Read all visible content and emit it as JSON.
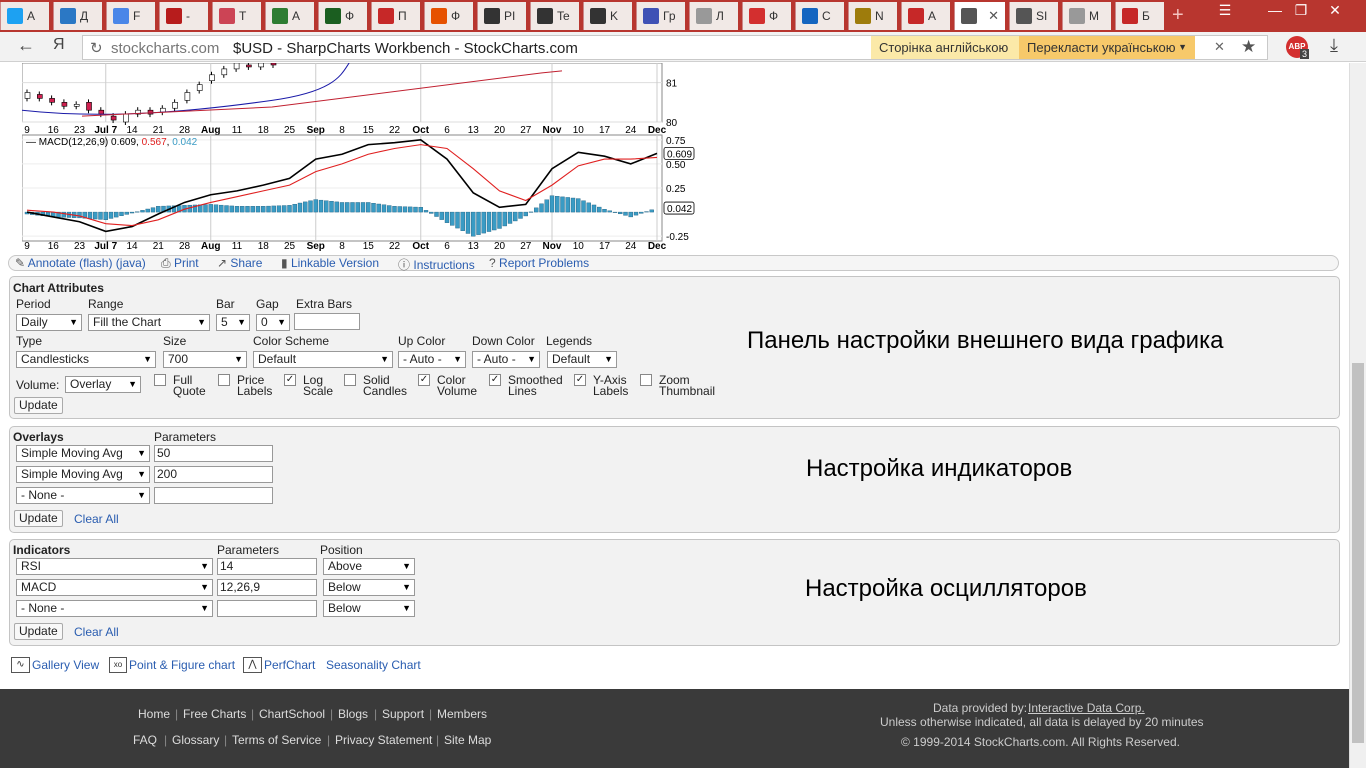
{
  "browser": {
    "tabs": [
      {
        "icon": "twitter-icon",
        "label": "A",
        "color": "#1da1f2"
      },
      {
        "icon": "m-icon",
        "label": "Д",
        "color": "#2b78c5"
      },
      {
        "icon": "g-icon",
        "label": "F",
        "color": "#4a86e8"
      },
      {
        "icon": "f-icon",
        "label": "-",
        "color": "#b71c1c"
      },
      {
        "icon": "chart-icon",
        "label": "T",
        "color": "#c45"
      },
      {
        "icon": "grid-icon",
        "label": "A",
        "color": "#2e7d32"
      },
      {
        "icon": "bars-icon",
        "label": "Ф",
        "color": "#1b5e20"
      },
      {
        "icon": "blocks-icon",
        "label": "П",
        "color": "#c62828"
      },
      {
        "icon": "circle-f-icon",
        "label": "Ф",
        "color": "#e65100"
      },
      {
        "icon": "ft-icon",
        "label": "PI",
        "color": "#333"
      },
      {
        "icon": "ft-icon",
        "label": "Te",
        "color": "#333"
      },
      {
        "icon": "ft-icon",
        "label": "K",
        "color": "#333"
      },
      {
        "icon": "pinwheel-icon",
        "label": "Гр",
        "color": "#3f51b5"
      },
      {
        "icon": "doc-icon",
        "label": "Л",
        "color": "#999"
      },
      {
        "icon": "f-script-icon",
        "label": "Ф",
        "color": "#d32f2f"
      },
      {
        "icon": "ob-icon",
        "label": "С",
        "color": "#1565c0"
      },
      {
        "icon": "coin-icon",
        "label": "N",
        "color": "#9e7c0c"
      },
      {
        "icon": "fa-icon",
        "label": "A",
        "color": "#c62828"
      },
      {
        "icon": "stockcharts-icon",
        "label": "",
        "color": "#555",
        "active": true
      },
      {
        "icon": "stockcharts-icon",
        "label": "SI",
        "color": "#555"
      },
      {
        "icon": "doc-icon",
        "label": "M",
        "color": "#999"
      },
      {
        "icon": "fm-icon",
        "label": "Б",
        "color": "#c62828"
      }
    ],
    "url_domain": "stockcharts.com",
    "url_title": "$USD - SharpCharts Workbench - StockCharts.com",
    "translate_source": "Сторінка англійською",
    "translate_target": "Перекласти українською",
    "adblock_count": "3"
  },
  "chart_data": [
    {
      "type": "candlestick",
      "x": [
        "9",
        "16",
        "23",
        "Jul 7",
        "14",
        "21",
        "28",
        "Aug",
        "11",
        "18",
        "25",
        "Sep",
        "8",
        "15",
        "22",
        "Oct",
        "6",
        "13",
        "20",
        "27",
        "Nov",
        "10",
        "17",
        "24",
        "Dec"
      ],
      "ylim_visible": [
        80,
        81.5
      ],
      "y_ticks": [
        "81",
        "80"
      ],
      "series": [
        {
          "name": "Price",
          "color": "#000"
        },
        {
          "name": "SMA 50",
          "color": "#1a1aa8"
        },
        {
          "name": "SMA 200",
          "color": "#c02030"
        }
      ]
    },
    {
      "type": "line",
      "legend": "MACD(12,26,9) 0.609, 0.567, 0.042",
      "legend_parts": {
        "name": "MACD(12,26,9)",
        "macd": "0.609",
        "signal": "0.567",
        "hist": "0.042"
      },
      "x": [
        "9",
        "16",
        "23",
        "Jul 7",
        "14",
        "21",
        "28",
        "Aug",
        "11",
        "18",
        "25",
        "Sep",
        "8",
        "15",
        "22",
        "Oct",
        "6",
        "13",
        "20",
        "27",
        "Nov",
        "10",
        "17",
        "24",
        "Dec"
      ],
      "y_ticks": [
        "0.75",
        "0.50",
        "0.25",
        "-0.25"
      ],
      "ylim": [
        -0.3,
        0.8
      ],
      "series": [
        {
          "name": "MACD",
          "color": "#000",
          "values": [
            0.0,
            -0.05,
            -0.1,
            -0.2,
            -0.15,
            -0.02,
            0.1,
            0.18,
            0.22,
            0.28,
            0.35,
            0.55,
            0.6,
            0.7,
            0.72,
            0.75,
            0.55,
            0.2,
            0.05,
            0.08,
            0.45,
            0.62,
            0.58,
            0.5,
            0.609
          ]
        },
        {
          "name": "Signal",
          "color": "#e02020",
          "values": [
            0.02,
            0.0,
            -0.04,
            -0.12,
            -0.14,
            -0.08,
            0.03,
            0.1,
            0.16,
            0.22,
            0.28,
            0.42,
            0.5,
            0.6,
            0.66,
            0.7,
            0.66,
            0.45,
            0.22,
            0.12,
            0.28,
            0.48,
            0.55,
            0.55,
            0.567
          ]
        },
        {
          "name": "Histogram",
          "color": "#3a9bc4",
          "values": [
            -0.02,
            -0.05,
            -0.06,
            -0.08,
            -0.01,
            0.06,
            0.07,
            0.08,
            0.06,
            0.06,
            0.07,
            0.13,
            0.1,
            0.1,
            0.06,
            0.05,
            -0.11,
            -0.25,
            -0.17,
            -0.04,
            0.17,
            0.14,
            0.03,
            -0.05,
            0.042
          ]
        }
      ],
      "value_labels": [
        "0.609",
        "0.042"
      ]
    }
  ],
  "toolbar": {
    "annotate": "Annotate (flash) (java)",
    "print": "Print",
    "share": "Share",
    "linkable": "Linkable Version",
    "instructions": "Instructions",
    "report": "Report Problems"
  },
  "attributes": {
    "title": "Chart Attributes",
    "period_label": "Period",
    "period": "Daily",
    "range_label": "Range",
    "range": "Fill the Chart",
    "bar_label": "Bar",
    "bar": "5",
    "gap_label": "Gap",
    "gap": "0",
    "extra_label": "Extra Bars",
    "extra": "",
    "type_label": "Type",
    "type": "Candlesticks",
    "size_label": "Size",
    "size": "700",
    "scheme_label": "Color Scheme",
    "scheme": "Default",
    "up_label": "Up Color",
    "up": "- Auto -",
    "down_label": "Down Color",
    "down": "- Auto -",
    "legends_label": "Legends",
    "legends": "Default",
    "volume_label": "Volume:",
    "volume": "Overlay",
    "checks": [
      {
        "l1": "Full",
        "l2": "Quote",
        "checked": false
      },
      {
        "l1": "Price",
        "l2": "Labels",
        "checked": false
      },
      {
        "l1": "Log",
        "l2": "Scale",
        "checked": true
      },
      {
        "l1": "Solid",
        "l2": "Candles",
        "checked": false
      },
      {
        "l1": "Color",
        "l2": "Volume",
        "checked": true
      },
      {
        "l1": "Smoothed",
        "l2": "Lines",
        "checked": true
      },
      {
        "l1": "Y-Axis",
        "l2": "Labels",
        "checked": true
      },
      {
        "l1": "Zoom",
        "l2": "Thumbnail",
        "checked": false
      }
    ],
    "update": "Update",
    "caption": "Панель настройки внешнего вида графика"
  },
  "overlays": {
    "title": "Overlays",
    "params_label": "Parameters",
    "rows": [
      {
        "name": "Simple Moving Avg",
        "params": "50"
      },
      {
        "name": "Simple Moving Avg",
        "params": "200"
      },
      {
        "name": "- None -",
        "params": ""
      }
    ],
    "update": "Update",
    "clear": "Clear All",
    "caption": "Настройка индикаторов"
  },
  "indicators": {
    "title": "Indicators",
    "params_label": "Parameters",
    "position_label": "Position",
    "rows": [
      {
        "name": "RSI",
        "params": "14",
        "position": "Above"
      },
      {
        "name": "MACD",
        "params": "12,26,9",
        "position": "Below"
      },
      {
        "name": "- None -",
        "params": "",
        "position": "Below"
      }
    ],
    "update": "Update",
    "clear": "Clear All",
    "caption": "Настройка осцилляторов"
  },
  "chartlinks": {
    "gallery": "Gallery View",
    "pf": "Point & Figure chart",
    "perf": "PerfChart",
    "seasonality": "Seasonality Chart"
  },
  "footer": {
    "row1": [
      "Home",
      "Free Charts",
      "ChartSchool",
      "Blogs",
      "Support",
      "Members"
    ],
    "row2": [
      "FAQ",
      "Glossary",
      "Terms of Service",
      "Privacy Statement",
      "Site Map"
    ],
    "provided_label": "Data provided by:",
    "provider": "Interactive Data Corp.",
    "delay": "Unless otherwise indicated, all data is delayed by 20 minutes",
    "copyright": "© 1999-2014 StockCharts.com. All Rights Reserved."
  }
}
